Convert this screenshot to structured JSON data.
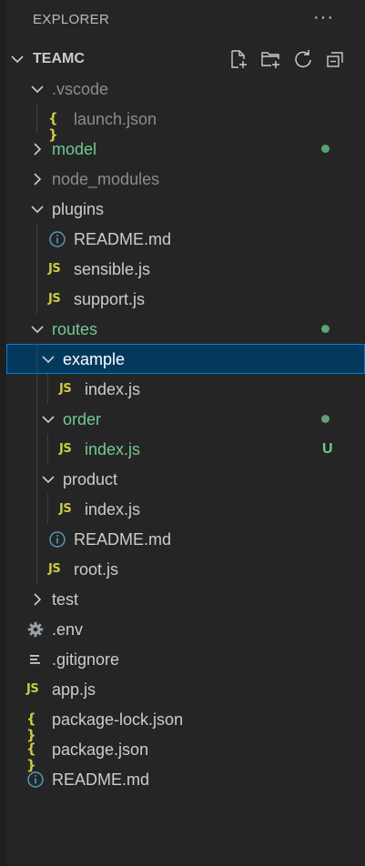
{
  "explorer": {
    "title": "EXPLORER",
    "more_label": "···",
    "section_title": "TEAMC",
    "actions": [
      "new-file-icon",
      "new-folder-icon",
      "refresh-icon",
      "collapse-all-icon"
    ]
  },
  "colors": {
    "background": "#252526",
    "text": "#cccccc",
    "muted": "#8c8c8c",
    "git_added": "#73c991",
    "selection": "#04395e",
    "focus_border": "#007fd4",
    "js_icon": "#cbcb41",
    "info_icon": "#519aba"
  },
  "tree": [
    {
      "label": ".vscode",
      "depth": 1,
      "kind": "folder",
      "expanded": true,
      "status": "ignored"
    },
    {
      "label": "launch.json",
      "depth": 2,
      "kind": "json",
      "status": "ignored"
    },
    {
      "label": "model",
      "depth": 1,
      "kind": "folder",
      "expanded": false,
      "status": "added",
      "decoration": "dot"
    },
    {
      "label": "node_modules",
      "depth": 1,
      "kind": "folder",
      "expanded": false,
      "status": "ignored"
    },
    {
      "label": "plugins",
      "depth": 1,
      "kind": "folder",
      "expanded": true
    },
    {
      "label": "README.md",
      "depth": 2,
      "kind": "info"
    },
    {
      "label": "sensible.js",
      "depth": 2,
      "kind": "js"
    },
    {
      "label": "support.js",
      "depth": 2,
      "kind": "js"
    },
    {
      "label": "routes",
      "depth": 1,
      "kind": "folder",
      "expanded": true,
      "status": "added",
      "decoration": "dot"
    },
    {
      "label": "example",
      "depth": 2,
      "kind": "folder",
      "expanded": true,
      "selected": true
    },
    {
      "label": "index.js",
      "depth": 3,
      "kind": "js"
    },
    {
      "label": "order",
      "depth": 2,
      "kind": "folder",
      "expanded": true,
      "status": "added",
      "decoration": "dot"
    },
    {
      "label": "index.js",
      "depth": 3,
      "kind": "js",
      "status": "added",
      "badge": "U"
    },
    {
      "label": "product",
      "depth": 2,
      "kind": "folder",
      "expanded": true
    },
    {
      "label": "index.js",
      "depth": 3,
      "kind": "js"
    },
    {
      "label": "README.md",
      "depth": 2,
      "kind": "info"
    },
    {
      "label": "root.js",
      "depth": 2,
      "kind": "js"
    },
    {
      "label": "test",
      "depth": 1,
      "kind": "folder",
      "expanded": false
    },
    {
      "label": ".env",
      "depth": 1,
      "kind": "gear",
      "root_file": true
    },
    {
      "label": ".gitignore",
      "depth": 1,
      "kind": "lines",
      "root_file": true
    },
    {
      "label": "app.js",
      "depth": 1,
      "kind": "js",
      "root_file": true
    },
    {
      "label": "package-lock.json",
      "depth": 1,
      "kind": "json",
      "root_file": true
    },
    {
      "label": "package.json",
      "depth": 1,
      "kind": "json",
      "root_file": true
    },
    {
      "label": "README.md",
      "depth": 1,
      "kind": "info",
      "root_file": true
    }
  ]
}
